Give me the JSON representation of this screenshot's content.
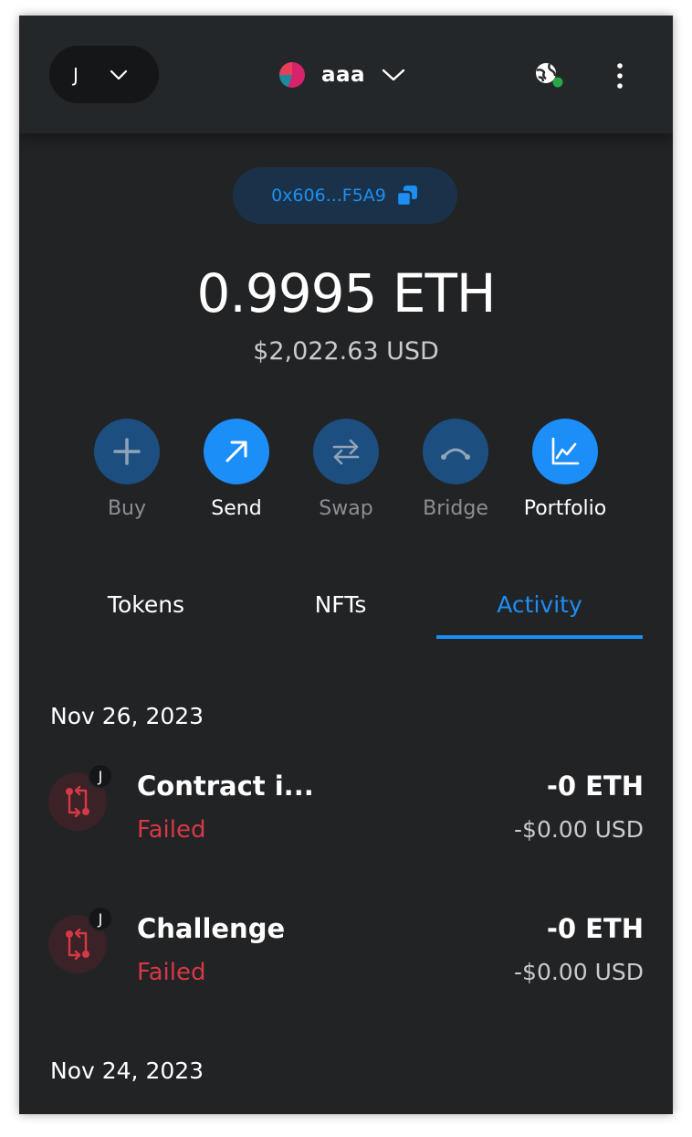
{
  "header": {
    "account_initial": "J",
    "network_name": "aaa"
  },
  "address": {
    "short": "0x606...F5A9"
  },
  "balance": {
    "amount": "0.9995",
    "unit": "ETH",
    "usd": "$2,022.63 USD"
  },
  "actions": [
    {
      "label": "Buy",
      "icon": "plus-icon",
      "enabled": false
    },
    {
      "label": "Send",
      "icon": "arrow-up-right-icon",
      "enabled": true
    },
    {
      "label": "Swap",
      "icon": "swap-arrows-icon",
      "enabled": false
    },
    {
      "label": "Bridge",
      "icon": "bridge-icon",
      "enabled": false
    },
    {
      "label": "Portfolio",
      "icon": "chart-icon",
      "enabled": true
    }
  ],
  "tabs": [
    {
      "label": "Tokens",
      "active": false
    },
    {
      "label": "NFTs",
      "active": false
    },
    {
      "label": "Activity",
      "active": true
    }
  ],
  "activity": {
    "groups": [
      {
        "date": "Nov 26, 2023",
        "items": [
          {
            "badge": "J",
            "title": "Contract i...",
            "status": "Failed",
            "amount": "-0 ETH",
            "usd": "-$0.00 USD"
          },
          {
            "badge": "J",
            "title": "Challenge",
            "status": "Failed",
            "amount": "-0 ETH",
            "usd": "-$0.00 USD"
          }
        ]
      },
      {
        "date": "Nov 24, 2023",
        "items": []
      }
    ]
  },
  "colors": {
    "background": "#222325",
    "accent": "#1c8ef8",
    "failed": "#d73847",
    "connected": "#28a745"
  }
}
